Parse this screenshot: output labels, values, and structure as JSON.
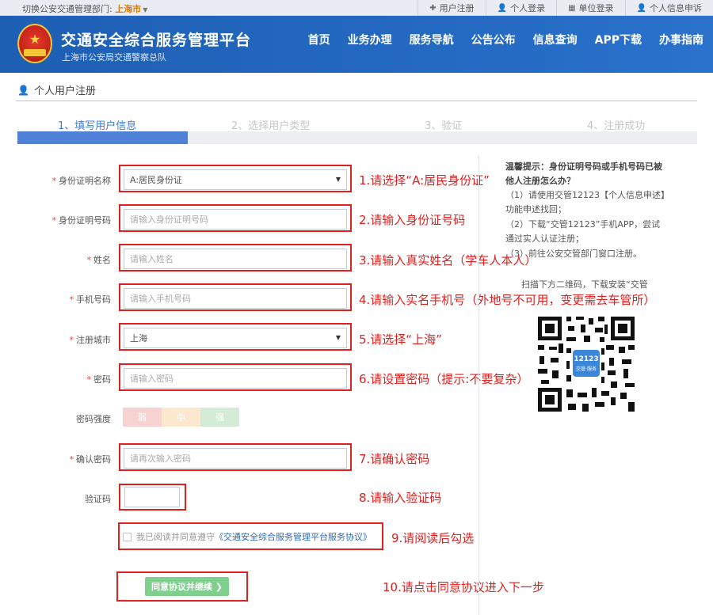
{
  "topbar": {
    "dept_label": "切换公安交通管理部门:",
    "city": "上海市",
    "links": [
      {
        "icon": "plus-icon",
        "label": "用户注册"
      },
      {
        "icon": "user-icon",
        "label": "个人登录"
      },
      {
        "icon": "building-icon",
        "label": "单位登录"
      },
      {
        "icon": "user-icon",
        "label": "个人信息申诉"
      }
    ]
  },
  "header": {
    "title": "交通安全综合服务管理平台",
    "subtitle": "上海市公安局交通警察总队",
    "nav": [
      "首页",
      "业务办理",
      "服务导航",
      "公告公布",
      "信息查询",
      "APP下载",
      "办事指南"
    ]
  },
  "breadcrumb": {
    "label": "个人用户注册"
  },
  "steps": [
    "1、填写用户信息",
    "2、选择用户类型",
    "3、验证",
    "4、注册成功"
  ],
  "progress_fraction": 0.25,
  "form": {
    "id_type_label": "身份证明名称",
    "id_type_value": "A:居民身份证",
    "id_no_label": "身份证明号码",
    "id_no_placeholder": "请输入身份证明号码",
    "name_label": "姓名",
    "name_placeholder": "请输入姓名",
    "phone_label": "手机号码",
    "phone_placeholder": "请输入手机号码",
    "city_label": "注册城市",
    "city_value": "上海",
    "password_label": "密码",
    "password_placeholder": "请输入密码",
    "strength_label": "密码强度",
    "strength_levels": [
      "弱",
      "中",
      "强"
    ],
    "confirm_label": "确认密码",
    "confirm_placeholder": "请再次输入密码",
    "captcha_label": "验证码",
    "agree_text": "我已阅读并同意遵守",
    "agree_link": "《交通安全综合服务管理平台服务协议》",
    "submit_label": "同意协议并继续 ❯"
  },
  "annotations": [
    "1.请选择“A:居民身份证”",
    "2.请输入身份证号码",
    "3.请输入真实姓名（学车人本人）",
    "4.请输入实名手机号（外地号不可用，变更需去车管所）",
    "5.请选择“上海”",
    "6.请设置密码（提示:不要复杂）",
    "7.请确认密码",
    "8.请输入验证码",
    "9.请阅读后勾选",
    "10.请点击同意协议进入下一步"
  ],
  "tips": {
    "title": "温馨提示：身份证明号码或手机号码已被他人注册怎么办？",
    "lines": [
      "（1）请使用交管12123【个人信息申述】功能申述找回；",
      "（2）下载“交管12123”手机APP，尝试通过实人认证注册；",
      "（3）前往公安交管部门窗口注册。"
    ],
    "scan": "扫描下方二维码，下载安装“交管",
    "qr_logo": "12123",
    "qr_logo_sub": "交管·服务"
  },
  "colors": {
    "brand_blue": "#1d5fb3",
    "annotation_red": "#e0201e",
    "step_active": "#3a7bd5",
    "button_green": "#7ed08c"
  }
}
